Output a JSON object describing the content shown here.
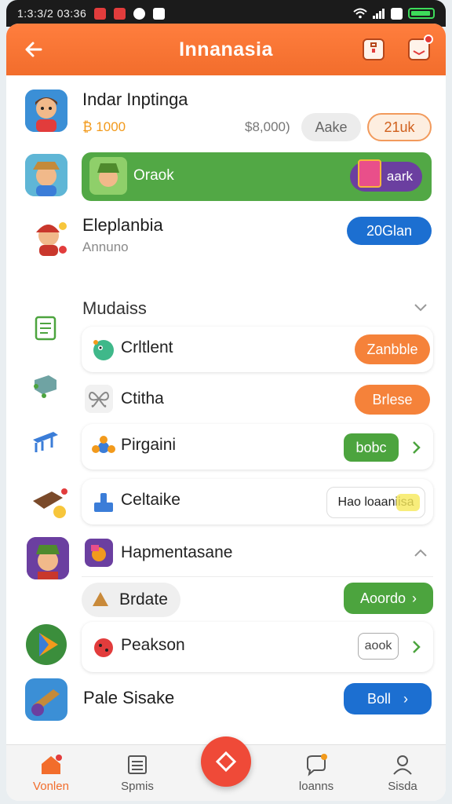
{
  "status_bar": {
    "time": "1:3:3/2 03:36"
  },
  "header": {
    "title": "Innanasia"
  },
  "top_rows": [
    {
      "title": "Indar Inptinga",
      "amount": "₿ 1000",
      "price": "$8,000)",
      "button_1": "Aake",
      "button_2": "21uk"
    },
    {
      "title": "Oraok",
      "badge_label": "aark"
    },
    {
      "title": "Eleplanbia",
      "subtitle": "Annuno",
      "button": "20Glan"
    }
  ],
  "section_1": {
    "title": "Mudaiss",
    "items": [
      {
        "label": "Crltlent",
        "button": "Zanbble"
      },
      {
        "label": "Ctitha",
        "button": "Brlese"
      },
      {
        "label": "Pirgaini",
        "button": "bobc"
      },
      {
        "label": "Celtaike",
        "button": "Hao loaaniisa"
      }
    ]
  },
  "section_2": {
    "title": "Hapmentasane",
    "items": [
      {
        "label": "Brdate",
        "button": "Aoordo"
      },
      {
        "label": "Peakson",
        "button": "aook"
      }
    ]
  },
  "bottom_row": {
    "title": "Pale Sisake",
    "button": "Boll"
  },
  "nav": {
    "items": [
      {
        "label": "Vonlen"
      },
      {
        "label": "Spmis"
      },
      {
        "label": "loanns"
      },
      {
        "label": "Sisda"
      }
    ]
  },
  "colors": {
    "accent": "#f26d2c",
    "green": "#4ca43e",
    "blue": "#1c6fd1",
    "purple": "#6b3fa0"
  }
}
